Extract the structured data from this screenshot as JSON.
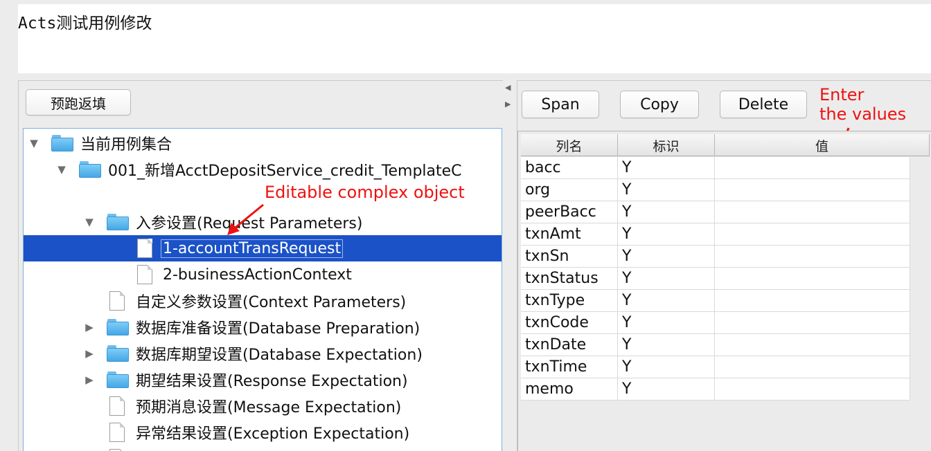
{
  "window": {
    "title": "Acts测试用例修改"
  },
  "left": {
    "prefill_button": "预跑返填",
    "tree": [
      {
        "label": "当前用例集合",
        "expanded": true,
        "icon": "folder-icon"
      },
      {
        "label": "001_新增AcctDepositService_credit_TemplateC",
        "expanded": true,
        "icon": "folder-icon"
      },
      {
        "label": "入参设置(Request Parameters)",
        "expanded": true,
        "icon": "folder-icon"
      },
      {
        "label": "1-accountTransRequest",
        "selected": true,
        "icon": "file-icon"
      },
      {
        "label": "2-businessActionContext",
        "icon": "file-icon"
      },
      {
        "label": "自定义参数设置(Context Parameters)",
        "icon": "file-icon"
      },
      {
        "label": "数据库准备设置(Database Preparation)",
        "expanded": false,
        "icon": "folder-icon"
      },
      {
        "label": "数据库期望设置(Database Expectation)",
        "expanded": false,
        "icon": "folder-icon"
      },
      {
        "label": "期望结果设置(Response Expectation)",
        "expanded": false,
        "icon": "folder-icon"
      },
      {
        "label": "预期消息设置(Message Expectation)",
        "icon": "file-icon"
      },
      {
        "label": "异常结果设置(Exception Expectation)",
        "icon": "file-icon"
      }
    ]
  },
  "right": {
    "buttons": {
      "span": "Span",
      "copy": "Copy",
      "delete": "Delete"
    },
    "table": {
      "headers": [
        "列名",
        "标识",
        "值"
      ],
      "rows": [
        {
          "name": "bacc",
          "flag": "Y",
          "value": ""
        },
        {
          "name": "org",
          "flag": "Y",
          "value": ""
        },
        {
          "name": "peerBacc",
          "flag": "Y",
          "value": ""
        },
        {
          "name": "txnAmt",
          "flag": "Y",
          "value": ""
        },
        {
          "name": "txnSn",
          "flag": "Y",
          "value": ""
        },
        {
          "name": "txnStatus",
          "flag": "Y",
          "value": ""
        },
        {
          "name": "txnType",
          "flag": "Y",
          "value": ""
        },
        {
          "name": "txnCode",
          "flag": "Y",
          "value": ""
        },
        {
          "name": "txnDate",
          "flag": "Y",
          "value": ""
        },
        {
          "name": "txnTime",
          "flag": "Y",
          "value": ""
        },
        {
          "name": "memo",
          "flag": "Y",
          "value": ""
        }
      ]
    }
  },
  "annotations": {
    "editable": "Editable complex object",
    "enter_line1": "Enter",
    "enter_line2": "the values"
  },
  "colors": {
    "selection": "#1b52c7",
    "annotation": "#ee1111",
    "folder": "#5bb8ef"
  }
}
